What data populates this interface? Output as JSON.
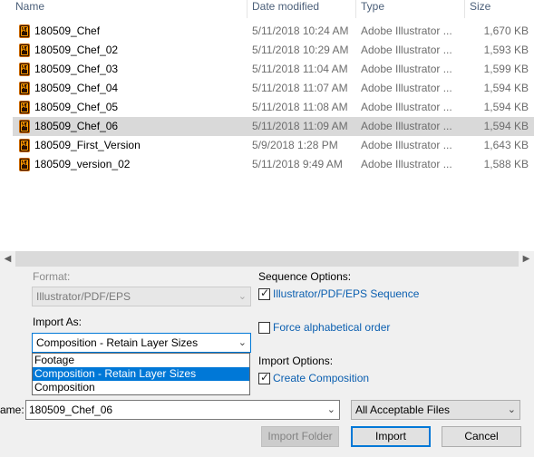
{
  "columns": {
    "name": "Name",
    "date": "Date modified",
    "type": "Type",
    "size": "Size"
  },
  "files": [
    {
      "name": "180509_Chef",
      "date": "5/11/2018 10:24 AM",
      "type": "Adobe Illustrator ...",
      "size": "1,670 KB",
      "icon": "illustrator-file-icon"
    },
    {
      "name": "180509_Chef_02",
      "date": "5/11/2018 10:29 AM",
      "type": "Adobe Illustrator ...",
      "size": "1,593 KB",
      "icon": "illustrator-file-icon"
    },
    {
      "name": "180509_Chef_03",
      "date": "5/11/2018 11:04 AM",
      "type": "Adobe Illustrator ...",
      "size": "1,599 KB",
      "icon": "illustrator-file-icon"
    },
    {
      "name": "180509_Chef_04",
      "date": "5/11/2018 11:07 AM",
      "type": "Adobe Illustrator ...",
      "size": "1,594 KB",
      "icon": "illustrator-file-icon"
    },
    {
      "name": "180509_Chef_05",
      "date": "5/11/2018 11:08 AM",
      "type": "Adobe Illustrator ...",
      "size": "1,594 KB",
      "icon": "illustrator-file-icon"
    },
    {
      "name": "180509_Chef_06",
      "date": "5/11/2018 11:09 AM",
      "type": "Adobe Illustrator ...",
      "size": "1,594 KB",
      "icon": "illustrator-file-icon",
      "selected": true
    },
    {
      "name": "180509_First_Version",
      "date": "5/9/2018 1:28 PM",
      "type": "Adobe Illustrator ...",
      "size": "1,643 KB",
      "icon": "illustrator-file-icon"
    },
    {
      "name": "180509_version_02",
      "date": "5/11/2018 9:49 AM",
      "type": "Adobe Illustrator ...",
      "size": "1,588 KB",
      "icon": "illustrator-file-icon"
    }
  ],
  "options": {
    "format_label": "Format:",
    "format_value": "Illustrator/PDF/EPS",
    "import_as_label": "Import As:",
    "import_as_value": "Composition - Retain Layer Sizes",
    "import_as_options": [
      "Footage",
      "Composition - Retain Layer Sizes",
      "Composition"
    ],
    "sequence_options_label": "Sequence Options:",
    "sequence_checkbox_label": "Illustrator/PDF/EPS Sequence",
    "sequence_checked": true,
    "force_alpha_label": "Force alphabetical order",
    "force_alpha_checked": false,
    "import_options_label": "Import Options:",
    "create_comp_label": "Create Composition",
    "create_comp_checked": true
  },
  "footer": {
    "filename_label": "ame:",
    "filename_value": "180509_Chef_06",
    "filter_value": "All Acceptable Files",
    "import_folder_label": "Import Folder",
    "import_label": "Import",
    "cancel_label": "Cancel"
  },
  "colors": {
    "selection": "#d9d9d9",
    "dropdown_highlight": "#0078d7",
    "link_label": "#0b5fb0"
  }
}
